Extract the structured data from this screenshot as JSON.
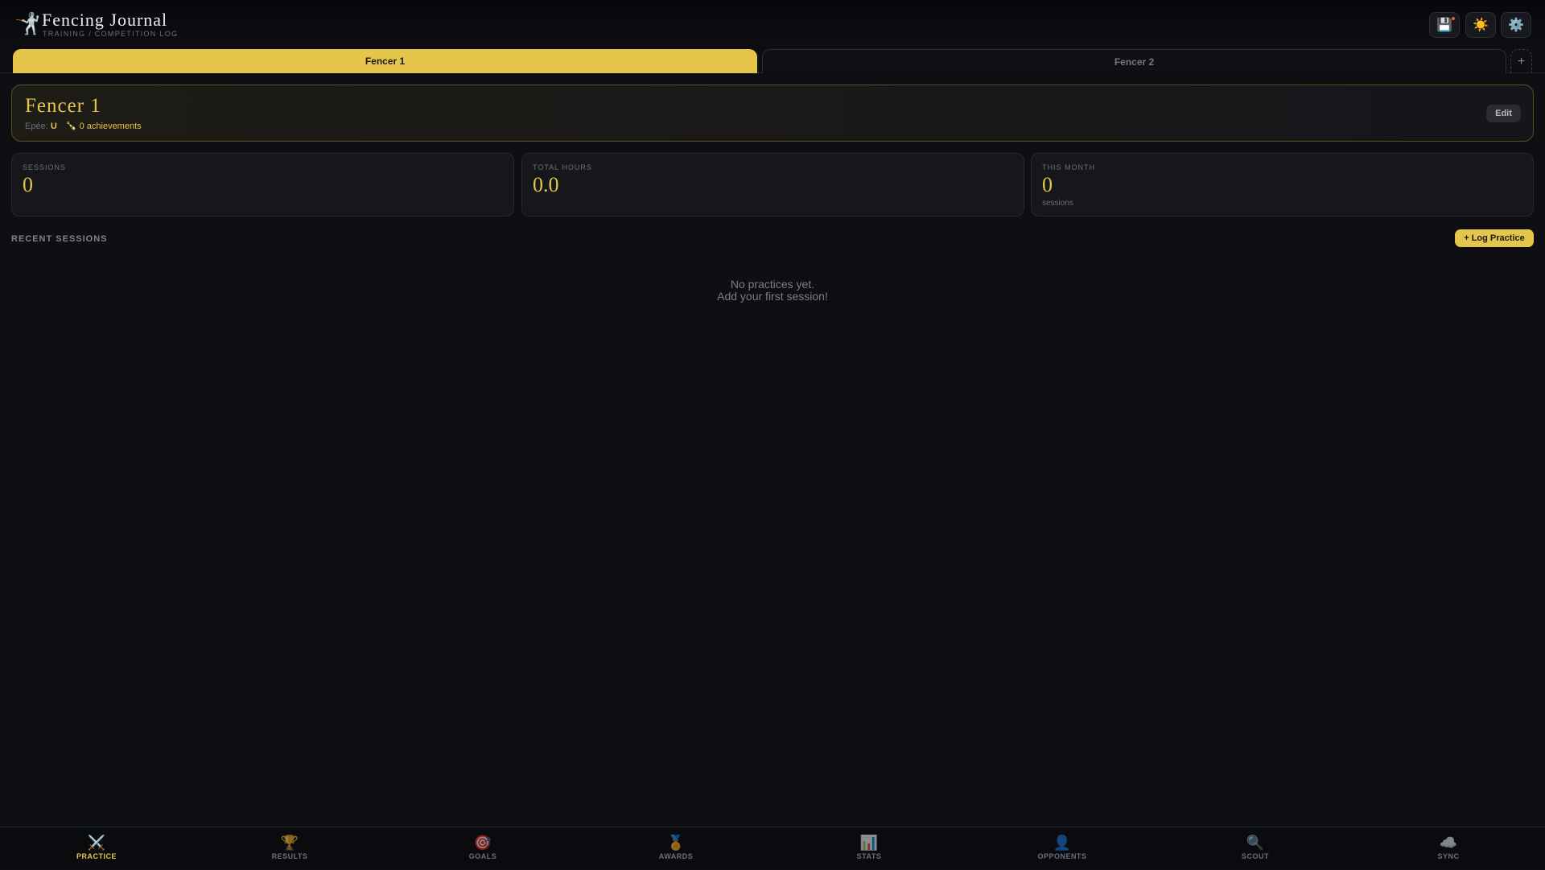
{
  "app": {
    "title": "Fencing Journal",
    "subtitle": "TRAINING / COMPETITION LOG"
  },
  "header_buttons": [
    {
      "icon": "save-icon",
      "glyph": "💾"
    },
    {
      "icon": "sun-icon",
      "glyph": "☀️"
    },
    {
      "icon": "gear-icon",
      "glyph": "⚙️"
    }
  ],
  "tabs": [
    {
      "label": "Fencer 1",
      "active": true
    },
    {
      "label": "Fencer 2",
      "active": false
    }
  ],
  "add_tab": "+",
  "profile": {
    "name": "Fencer 1",
    "weapon_label": "Epée:",
    "rating": "U",
    "achievements": "0 achievements",
    "edit": "Edit"
  },
  "stats": [
    {
      "label": "SESSIONS",
      "value": "0"
    },
    {
      "label": "TOTAL HOURS",
      "value": "0.0"
    },
    {
      "label": "THIS MONTH",
      "value": "0",
      "sub": "sessions"
    }
  ],
  "recent": {
    "title": "RECENT SESSIONS",
    "log_button": "+ Log Practice",
    "empty_line1": "No practices yet.",
    "empty_line2": "Add your first session!"
  },
  "nav": [
    {
      "label": "PRACTICE",
      "glyph": "⚔️"
    },
    {
      "label": "RESULTS",
      "glyph": "🏆"
    },
    {
      "label": "GOALS",
      "glyph": "🎯"
    },
    {
      "label": "AWARDS",
      "glyph": "🏅"
    },
    {
      "label": "STATS",
      "glyph": "📊"
    },
    {
      "label": "OPPONENTS",
      "glyph": "👤"
    },
    {
      "label": "SCOUT",
      "glyph": "🔍"
    },
    {
      "label": "SYNC",
      "glyph": "☁️"
    }
  ],
  "accent": "#e6c54b"
}
